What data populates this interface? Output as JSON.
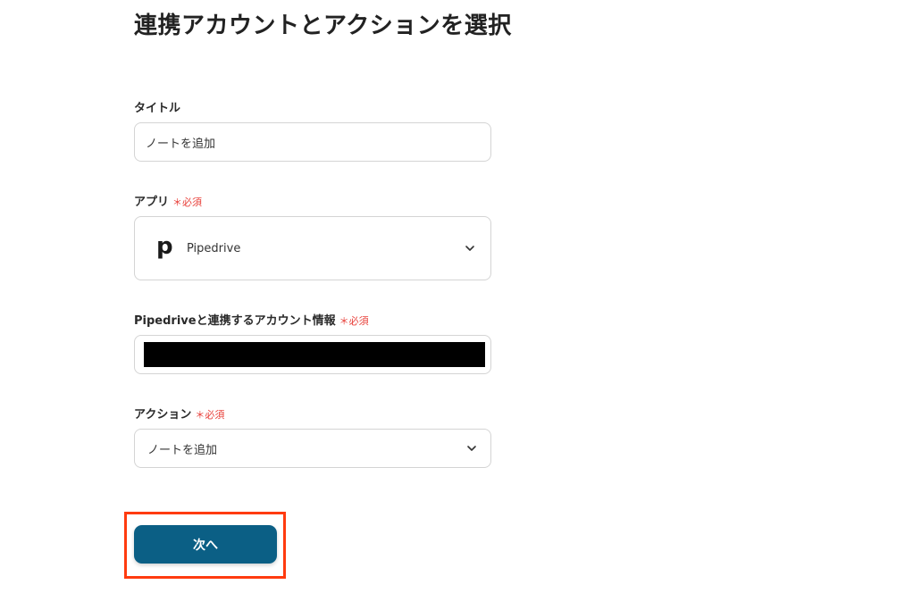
{
  "page_title": "連携アカウントとアクションを選択",
  "form": {
    "title_field": {
      "label": "タイトル",
      "value": "ノートを追加"
    },
    "app_field": {
      "label": "アプリ",
      "required": "＊必須",
      "selected_app": "Pipedrive",
      "app_logo_letter": "p",
      "icon": "chevron-down-icon"
    },
    "account_field": {
      "label": "Pipedriveと連携するアカウント情報",
      "required": "＊必須"
    },
    "action_field": {
      "label": "アクション",
      "required": "＊必須",
      "selected_value": "ノートを追加",
      "icon": "chevron-down-icon"
    }
  },
  "next_button": {
    "label": "次へ"
  },
  "colors": {
    "primary_button": "#0b5f85",
    "required": "#e8413b",
    "highlight_box": "#ff3b0f"
  }
}
